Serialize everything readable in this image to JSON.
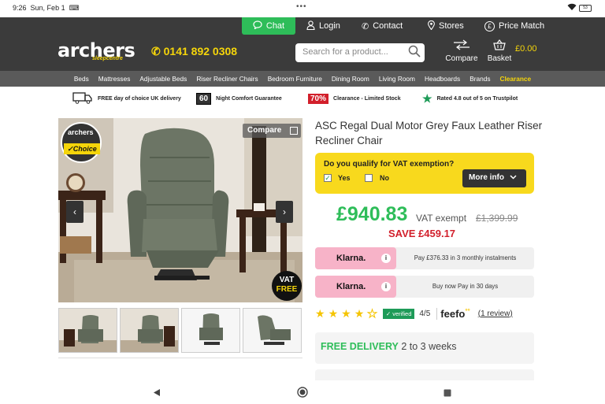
{
  "status_bar": {
    "time": "9:26",
    "date": "Sun, Feb 1",
    "battery": "53"
  },
  "topbar": {
    "chat": "Chat",
    "login": "Login",
    "contact": "Contact",
    "stores": "Stores",
    "price_match": "Price Match"
  },
  "header": {
    "logo": "archers",
    "logo_sub": "sleepcentre",
    "phone": "0141 892 0308",
    "search_placeholder": "Search for a product...",
    "compare": "Compare",
    "basket": "Basket",
    "basket_total": "£0.00"
  },
  "categories": [
    "Beds",
    "Mattresses",
    "Adjustable Beds",
    "Riser Recliner Chairs",
    "Bedroom Furniture",
    "Dining Room",
    "Living Room",
    "Headboards",
    "Brands"
  ],
  "category_highlight": "Clearance",
  "usps": {
    "delivery": "FREE day of choice UK delivery",
    "nights_num": "60",
    "nights": "Night Comfort Guarantee",
    "clearance_num": "70%",
    "clearance": "Clearance - Limited Stock",
    "trustpilot": "Rated 4.8 out of 5 on Trustpilot"
  },
  "gallery": {
    "compare": "Compare",
    "badge_brand": "archers",
    "badge_choice": "✓Choice",
    "vat_line1": "VAT",
    "vat_line2": "FREE",
    "prev": "‹",
    "next": "›"
  },
  "product": {
    "title": "ASC Regal Dual Motor Grey Faux Leather Riser Recliner Chair",
    "vat_question": "Do you qualify for VAT exemption?",
    "vat_yes": "Yes",
    "vat_no": "No",
    "vat_yes_checked": true,
    "more_info": "More info",
    "price": "£940.83",
    "vat_exempt": "VAT exempt",
    "old_price": "£1,399.99",
    "save": "SAVE £459.17"
  },
  "klarna": [
    {
      "logo": "Klarna.",
      "text": "Pay £376.33 in 3 monthly instalments"
    },
    {
      "logo": "Klarna.",
      "text": "Buy now Pay in 30 days"
    }
  ],
  "reviews": {
    "stars": 4,
    "verified": "verified",
    "rating": "4/5",
    "feefo": "feefo",
    "review_link": "(1 review)"
  },
  "delivery": {
    "free": "FREE DELIVERY",
    "weeks": "2 to 3 weeks"
  },
  "colors": {
    "green": "#2ebd59",
    "yellow": "#f8d91d",
    "red": "#d21f2b",
    "dark": "#3b3b3b",
    "klarna_pink": "#f7b3c8"
  }
}
